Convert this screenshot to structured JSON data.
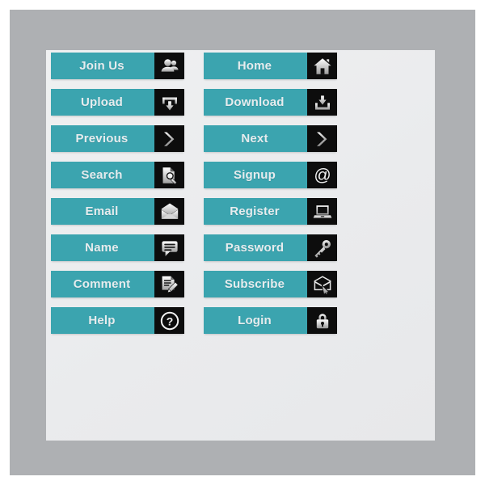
{
  "theme": {
    "background": "#ffffff",
    "frame_color": "#aeb0b3",
    "panel_color": "#ebecee",
    "button_color": "#3ba4af",
    "icon_box_color": "#0d0d0d",
    "label_color": "#e6ecee"
  },
  "columns": [
    {
      "name": "left-column",
      "buttons": [
        {
          "label": "Join Us",
          "icon": "users-icon"
        },
        {
          "label": "Upload",
          "icon": "upload-tray-icon"
        },
        {
          "label": "Previous",
          "icon": "arrow-right-icon"
        },
        {
          "label": "Search",
          "icon": "document-search-icon"
        },
        {
          "label": "Email",
          "icon": "envelope-icon"
        },
        {
          "label": "Name",
          "icon": "speech-bubble-icon"
        },
        {
          "label": "Comment",
          "icon": "document-pen-icon"
        },
        {
          "label": "Help",
          "icon": "question-mark-circle-icon"
        }
      ]
    },
    {
      "name": "right-column",
      "buttons": [
        {
          "label": "Home",
          "icon": "house-icon"
        },
        {
          "label": "Download",
          "icon": "download-tray-icon"
        },
        {
          "label": "Next",
          "icon": "arrow-right-icon"
        },
        {
          "label": "Signup",
          "icon": "at-sign-icon"
        },
        {
          "label": "Register",
          "icon": "laptop-icon"
        },
        {
          "label": "Password",
          "icon": "key-icon"
        },
        {
          "label": "Subscribe",
          "icon": "envelope-cursor-icon"
        },
        {
          "label": "Login",
          "icon": "padlock-icon"
        }
      ]
    }
  ]
}
